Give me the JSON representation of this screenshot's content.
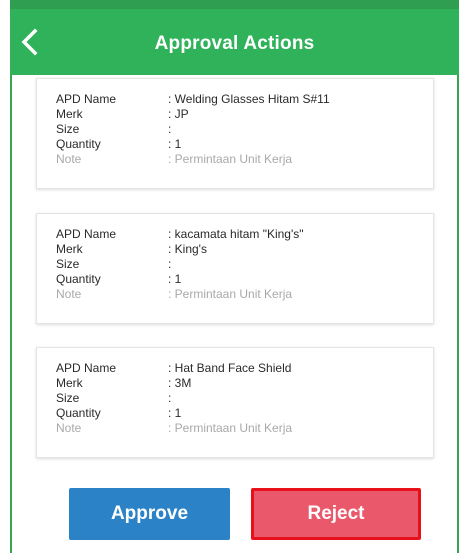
{
  "colors": {
    "app_bar": "#2fb25a",
    "approve": "#2b82c6",
    "reject": "#e9586b",
    "reject_border": "#e8101a"
  },
  "header": {
    "back_icon": "chevron-left-icon",
    "title": "Approval Actions"
  },
  "labels": {
    "apd_name": "APD Name",
    "merk": "Merk",
    "size": "Size",
    "quantity": "Quantity",
    "note": "Note"
  },
  "items": [
    {
      "apd_name": ": Welding Glasses Hitam S#11",
      "merk": ": JP",
      "size": ":",
      "quantity": ": 1",
      "note": ": Permintaan Unit Kerja"
    },
    {
      "apd_name": ": kacamata hitam \"King's\"",
      "merk": ": King's",
      "size": ":",
      "quantity": ": 1",
      "note": ": Permintaan Unit Kerja"
    },
    {
      "apd_name": ": Hat Band Face Shield",
      "merk": ": 3M",
      "size": ":",
      "quantity": ": 1",
      "note": ": Permintaan Unit Kerja"
    }
  ],
  "actions": {
    "approve_label": "Approve",
    "reject_label": "Reject"
  }
}
